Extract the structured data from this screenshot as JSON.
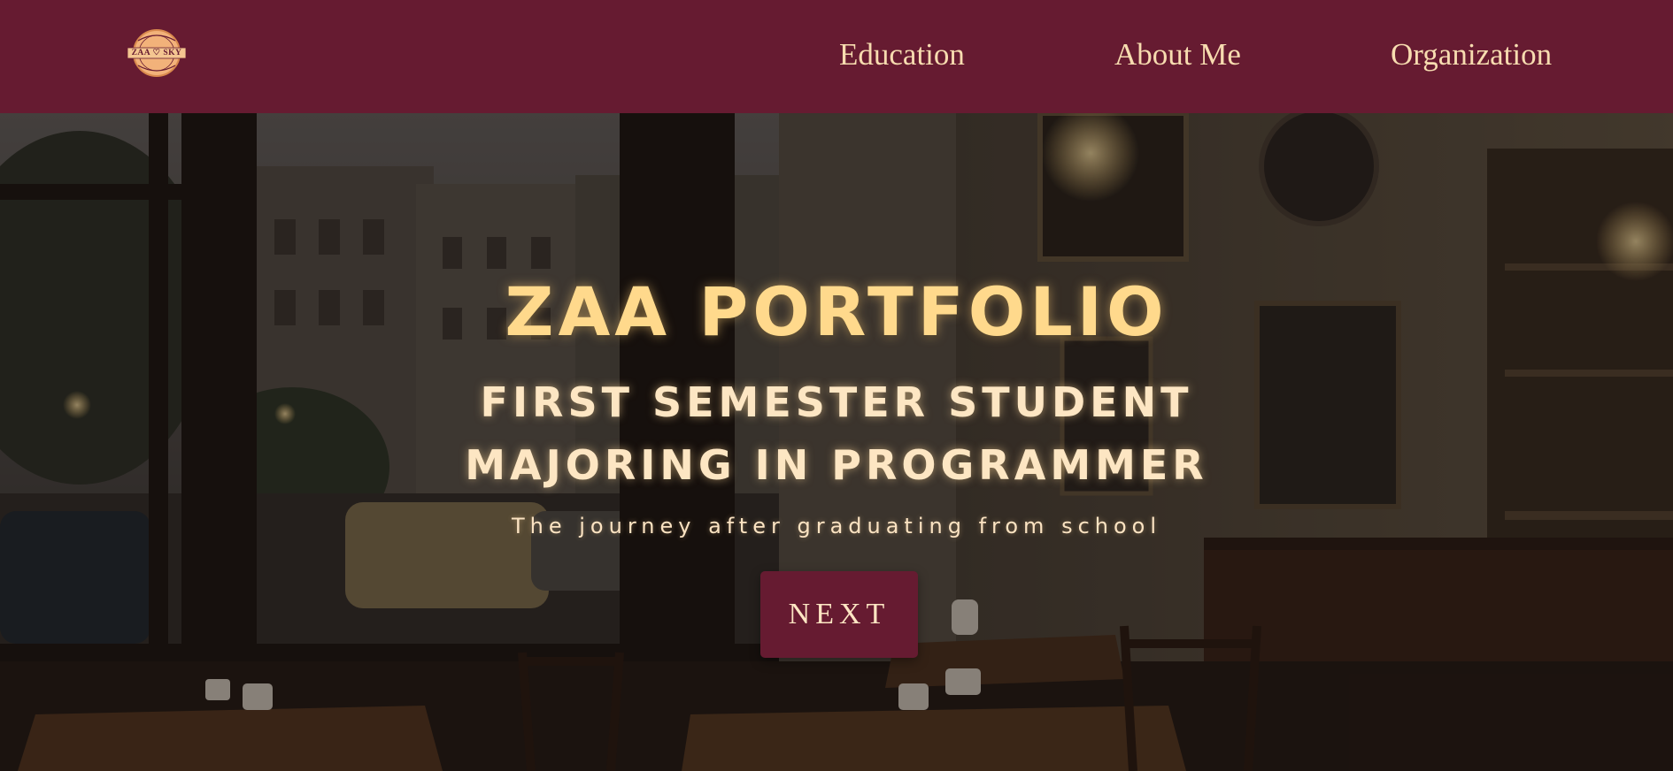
{
  "logo": {
    "arc_top": "HAPPINESS",
    "wordmark": "ZAA ♡ SKY",
    "arc_bottom": "STUDENT"
  },
  "nav": {
    "items": [
      {
        "label": "Education"
      },
      {
        "label": "About Me"
      },
      {
        "label": "Organization"
      }
    ]
  },
  "hero": {
    "title": "ZAA PORTFOLIO",
    "subtitle_line1": "FIRST SEMESTER STUDENT",
    "subtitle_line2": "MAJORING IN PROGRAMMER",
    "tagline": "The journey after graduating from school",
    "next_button": "NEXT",
    "background_image": "dim cafe interior with window view of street, parked cars and buildings"
  },
  "colors": {
    "brand": "#661b31",
    "nav_text": "#f7dcb0",
    "title": "#ffd98c",
    "subtitle": "#fde6c3"
  }
}
